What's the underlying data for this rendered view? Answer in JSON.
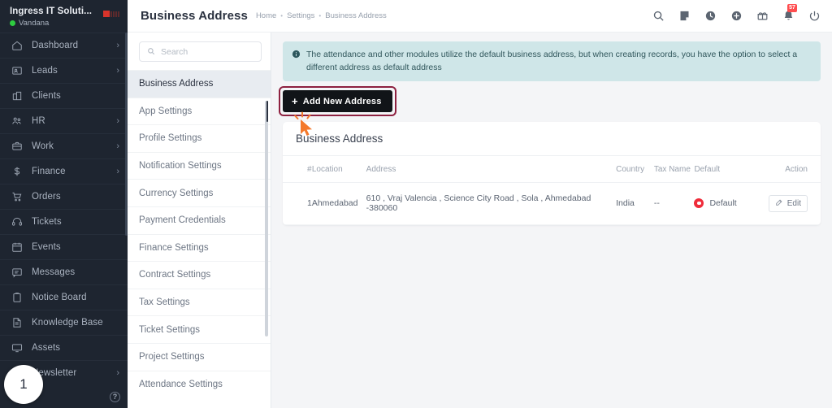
{
  "sidebar": {
    "company": "Ingress IT Soluti...",
    "user": "Vandana",
    "items": [
      {
        "label": "Dashboard",
        "icon": "home-icon",
        "chevron": "›"
      },
      {
        "label": "Leads",
        "icon": "leads-icon",
        "chevron": "›"
      },
      {
        "label": "Clients",
        "icon": "clients-icon",
        "chevron": ""
      },
      {
        "label": "HR",
        "icon": "hr-icon",
        "chevron": "›"
      },
      {
        "label": "Work",
        "icon": "work-icon",
        "chevron": "›"
      },
      {
        "label": "Finance",
        "icon": "finance-icon",
        "chevron": "›"
      },
      {
        "label": "Orders",
        "icon": "orders-icon",
        "chevron": ""
      },
      {
        "label": "Tickets",
        "icon": "tickets-icon",
        "chevron": ""
      },
      {
        "label": "Events",
        "icon": "events-icon",
        "chevron": ""
      },
      {
        "label": "Messages",
        "icon": "messages-icon",
        "chevron": ""
      },
      {
        "label": "Notice Board",
        "icon": "notice-board-icon",
        "chevron": ""
      },
      {
        "label": "Knowledge Base",
        "icon": "knowledge-base-icon",
        "chevron": ""
      },
      {
        "label": "Assets",
        "icon": "assets-icon",
        "chevron": ""
      },
      {
        "label": "Newsletter",
        "icon": "newsletter-icon",
        "chevron": "›"
      }
    ],
    "help_label": "?",
    "step_badge": "1"
  },
  "topbar": {
    "title": "Business Address",
    "breadcrumbs": [
      "Home",
      "Settings",
      "Business Address"
    ],
    "separator": "•",
    "icons": [
      "search-icon",
      "notes-icon",
      "clock-icon",
      "plus-circle-icon",
      "gift-icon",
      "bell-icon",
      "power-icon"
    ],
    "notification_count": "57"
  },
  "settings": {
    "search_placeholder": "Search",
    "search_value": "",
    "items": [
      "Business Address",
      "App Settings",
      "Profile Settings",
      "Notification Settings",
      "Currency Settings",
      "Payment Credentials",
      "Finance Settings",
      "Contract Settings",
      "Tax Settings",
      "Ticket Settings",
      "Project Settings",
      "Attendance Settings"
    ],
    "active_index": 0
  },
  "content": {
    "alert": "The attendance and other modules utilize the default business address, but when creating records, you have the option to select a different address as default address",
    "add_button": "Add New Address",
    "add_button_plus": "+",
    "card_title": "Business Address",
    "table": {
      "headers": [
        "#",
        "Location",
        "Address",
        "Country",
        "Tax Name",
        "Default",
        "Action"
      ],
      "rows": [
        {
          "num": "1",
          "location": "Ahmedabad",
          "address": "610 , Vraj Valencia , Science City Road , Sola , Ahmedabad -380060",
          "country": "India",
          "tax_name": "--",
          "default": "Default",
          "action": "Edit"
        }
      ]
    }
  },
  "colors": {
    "sidebar_bg": "#1e2530",
    "accent_dark": "#111418",
    "alert_bg": "#cfe6e8",
    "highlight_ring": "#8e2140",
    "default_red": "#ef2c3a",
    "badge_red": "#ff4d4f",
    "online_green": "#2ecc40",
    "cursor_orange": "#f4792b"
  }
}
